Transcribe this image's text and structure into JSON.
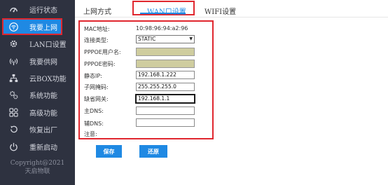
{
  "sidebar": {
    "items": [
      {
        "label": "运行状态",
        "icon": "dashboard-icon"
      },
      {
        "label": "我要上网",
        "icon": "wifi-icon",
        "active": true
      },
      {
        "label": "LAN口设置",
        "icon": "gear-icon"
      },
      {
        "label": "我要供网",
        "icon": "broadcast-icon"
      },
      {
        "label": "云BOX功能",
        "icon": "network-icon"
      },
      {
        "label": "系统功能",
        "icon": "gears-icon"
      },
      {
        "label": "高级功能",
        "icon": "grid-icon"
      },
      {
        "label": "恢复出厂",
        "icon": "restore-icon"
      },
      {
        "label": "重新启动",
        "icon": "power-icon"
      }
    ],
    "copyright_line1": "Copyright@2021",
    "copyright_line2": "天启物联"
  },
  "tabs": [
    {
      "label": "上网方式"
    },
    {
      "label": "WAN口设置",
      "active": true
    },
    {
      "label": "WIFI设置"
    }
  ],
  "form": {
    "mac_label": "MAC地址:",
    "mac_value": "10:98:96:94:a2:96",
    "conn_type_label": "连接类型:",
    "conn_type_value": "STATIC",
    "pppoe_user_label": "PPPOE用户名:",
    "pppoe_user_value": "",
    "pppoe_pass_label": "PPPOE密码:",
    "pppoe_pass_value": "",
    "static_ip_label": "静态IP:",
    "static_ip_value": "192.168.1.222",
    "subnet_label": "子网掩码:",
    "subnet_value": "255.255.255.0",
    "gateway_label": "缺省网关:",
    "gateway_value": "192.168.1.1",
    "primary_dns_label": "主DNS:",
    "primary_dns_value": "",
    "secondary_dns_label": "辅DNS:",
    "secondary_dns_value": "",
    "note_label": "注意:"
  },
  "buttons": {
    "save": "保存",
    "restore": "还原"
  },
  "colors": {
    "sidebar_bg": "#2e3240",
    "accent": "#1f89e3",
    "highlight": "#e0272f",
    "disabled_field": "#cfcd9f"
  }
}
